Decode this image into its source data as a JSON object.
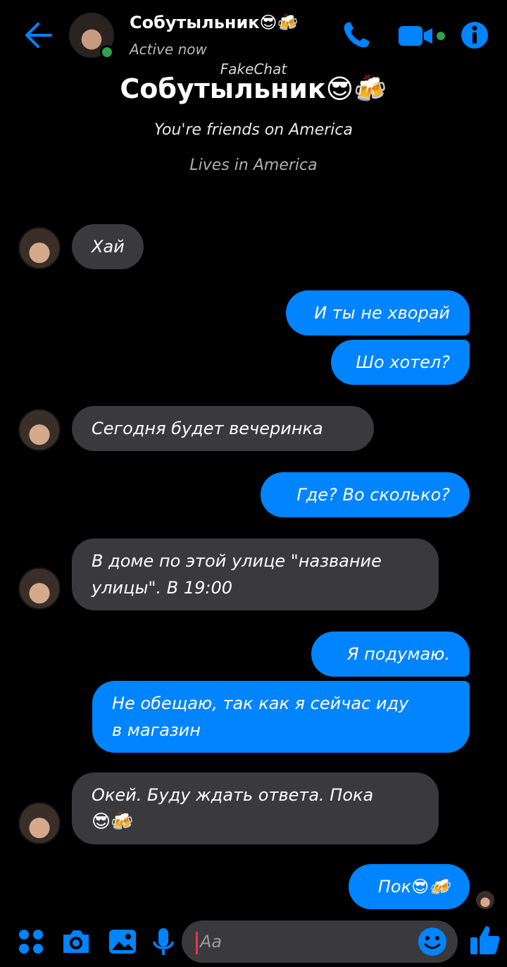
{
  "header": {
    "contact_name": "Собутыльник😎🍻",
    "status": "Active now"
  },
  "watermark": "FakeChat",
  "profile": {
    "name": "Собутыльник😎🍻",
    "friends_line": "You're friends on America",
    "lives_line": "Lives in America"
  },
  "messages": [
    {
      "dir": "in",
      "text": "Хай"
    },
    {
      "dir": "out",
      "text": "И ты не хворай"
    },
    {
      "dir": "out",
      "text": "Шо хотел?"
    },
    {
      "dir": "in",
      "text": "Сегодня будет вечеринка"
    },
    {
      "dir": "out",
      "text": "Где? Во сколько?"
    },
    {
      "dir": "in",
      "line1": "В доме по этой улице \"название",
      "line2": "улицы\". В 19:00"
    },
    {
      "dir": "out",
      "text": "Я подумаю."
    },
    {
      "dir": "out",
      "line1": "Не обещаю, так как я сейчас иду",
      "line2": "в магазин"
    },
    {
      "dir": "in",
      "line1": "Окей. Буду ждать ответа. Пока",
      "line2": "😎🍻"
    },
    {
      "dir": "out",
      "text": "Пок😎🍻"
    }
  ],
  "composer": {
    "placeholder": "Aa"
  },
  "icons": {
    "back": "back-arrow-icon",
    "phone": "phone-icon",
    "video": "video-camera-icon",
    "info": "info-icon",
    "apps": "apps-grid-icon",
    "camera": "camera-icon",
    "gallery": "gallery-icon",
    "mic": "microphone-icon",
    "emoji": "emoji-icon",
    "like": "thumbs-up-icon"
  },
  "colors": {
    "accent": "#0084ff",
    "incoming_bubble": "#3a3a3c",
    "online": "#31a24c",
    "background": "#000000"
  }
}
